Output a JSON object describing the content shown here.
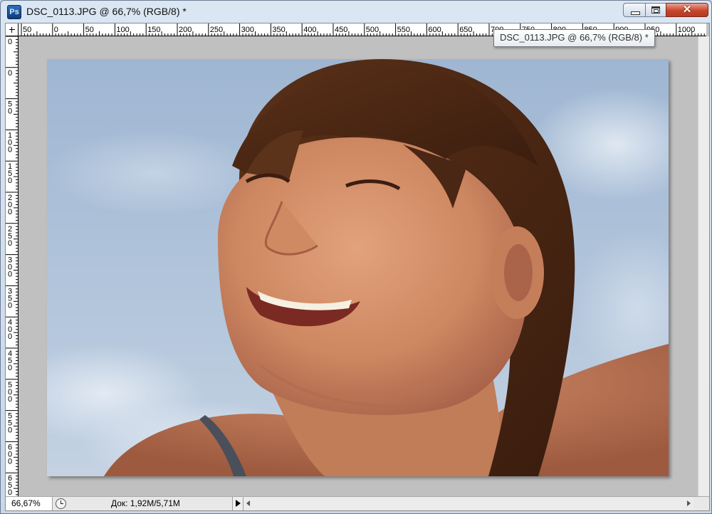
{
  "window": {
    "app_icon": "photoshop-icon",
    "app_icon_text": "Ps",
    "title": "DSC_0113.JPG @ 66,7% (RGB/8) *",
    "close_glyph": "✕"
  },
  "tooltip": {
    "text": "DSC_0113.JPG @ 66,7% (RGB/8) *"
  },
  "ruler": {
    "horizontal_labels": [
      "50",
      "0",
      "50",
      "100",
      "150",
      "200",
      "250",
      "300",
      "350",
      "400",
      "450",
      "500",
      "550",
      "600",
      "650",
      "700",
      "750",
      "800",
      "850",
      "900",
      "950",
      "1000"
    ],
    "vertical_labels": [
      "0",
      "0",
      "50",
      "100",
      "150",
      "200",
      "250",
      "300",
      "350",
      "400",
      "450",
      "500",
      "550",
      "600",
      "650"
    ]
  },
  "status": {
    "zoom": "66,67%",
    "doc_info": "Док: 1,92M/5,71M"
  },
  "colors": {
    "sky": "#a9bfd8",
    "skin": "#cf8a64",
    "hair": "#4a2714",
    "close_red": "#c8462b"
  }
}
